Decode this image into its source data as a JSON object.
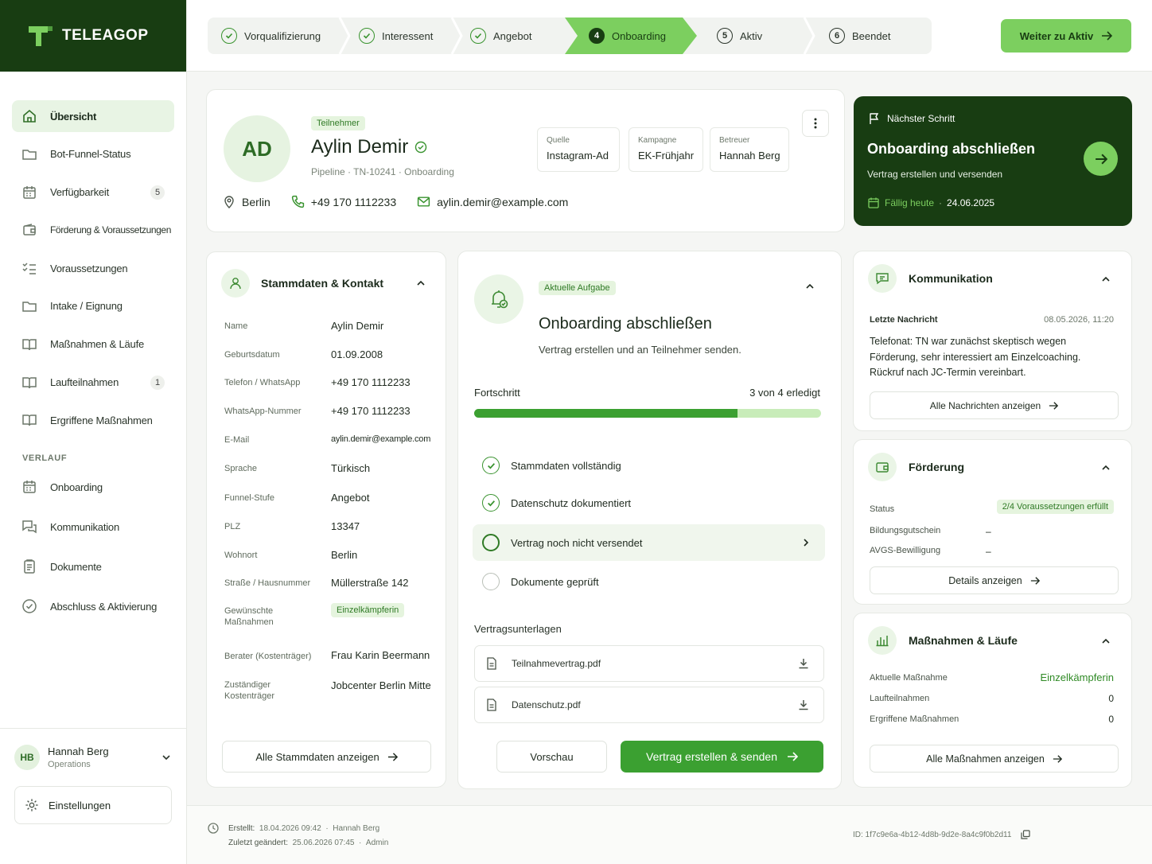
{
  "brand": {
    "name": "TELEAGOP"
  },
  "colors": {
    "brand_dark": "#183d12",
    "accent": "#7ccf5f",
    "primary": "#3ba031",
    "success": "#39932f"
  },
  "sidebar": {
    "items": [
      {
        "label": "Übersicht",
        "icon": "home-icon",
        "active": true
      },
      {
        "label": "Bot-Funnel-Status",
        "icon": "folder-icon"
      },
      {
        "label": "Verfügbarkeit",
        "icon": "calendar-icon",
        "badge": "5"
      },
      {
        "label": "Förderung & Voraussetzungen",
        "icon": "wallet-icon"
      },
      {
        "label": "Voraussetzungen",
        "icon": "checklist-icon"
      },
      {
        "label": "Intake / Eignung",
        "icon": "folder-icon"
      },
      {
        "label": "Maßnahmen & Läufe",
        "icon": "book-icon"
      },
      {
        "label": "Laufteilnahmen",
        "icon": "book-icon",
        "badge": "1"
      },
      {
        "label": "Ergriffene Maßnahmen",
        "icon": "book-icon"
      }
    ],
    "section_label": "VERLAUF",
    "history_items": [
      {
        "label": "Onboarding",
        "icon": "calendar-icon"
      },
      {
        "label": "Kommunikation",
        "icon": "chat-icon"
      },
      {
        "label": "Dokumente",
        "icon": "clipboard-icon"
      },
      {
        "label": "Abschluss & Aktivierung",
        "icon": "check-circle-icon"
      }
    ],
    "user": {
      "initials": "HB",
      "name": "Hannah Berg",
      "role": "Operations"
    },
    "settings_label": "Einstellungen"
  },
  "stepper": {
    "steps": [
      {
        "label": "Vorqualifizierung",
        "state": "done"
      },
      {
        "label": "Interessent",
        "state": "done"
      },
      {
        "label": "Angebot",
        "state": "done"
      },
      {
        "label": "Onboarding",
        "state": "active",
        "num": "4"
      },
      {
        "label": "Aktiv",
        "state": "todo",
        "num": "5"
      },
      {
        "label": "Beendet",
        "state": "todo",
        "num": "6"
      }
    ],
    "next_button": "Weiter zu Aktiv"
  },
  "profile": {
    "initials": "AD",
    "tag": "Teilnehmer",
    "name": "Aylin Demir",
    "pipeline": "Pipeline · TN-10241 · Onboarding",
    "city": "Berlin",
    "phone": "+49 170 1112233",
    "email": "aylin.demir@example.com",
    "info": [
      {
        "key": "Quelle",
        "value": "Instagram-Ad"
      },
      {
        "key": "Kampagne",
        "value": "EK-Frühjahr"
      },
      {
        "key": "Betreuer",
        "value": "Hannah Berg"
      }
    ]
  },
  "next_step": {
    "label": "Nächster Schritt",
    "title": "Onboarding abschließen",
    "desc": "Vertrag erstellen und versenden",
    "due": "Fällig heute",
    "date": "24.06.2025"
  },
  "stammdaten": {
    "title": "Stammdaten & Kontakt",
    "fields": [
      {
        "key": "Name",
        "value": "Aylin Demir"
      },
      {
        "key": "Geburtsdatum",
        "value": "01.09.2008"
      },
      {
        "key": "Telefon / WhatsApp",
        "value": "+49 170 1112233"
      },
      {
        "key": "WhatsApp-Nummer",
        "value": "+49 170 1112233"
      },
      {
        "key": "E-Mail",
        "value": "aylin.demir@example.com"
      },
      {
        "key": "Sprache",
        "value": "Türkisch"
      },
      {
        "key": "Funnel-Stufe",
        "value": "Angebot"
      },
      {
        "key": "PLZ",
        "value": "13347"
      },
      {
        "key": "Wohnort",
        "value": "Berlin"
      },
      {
        "key": "Straße / Hausnummer",
        "value": "Müllerstraße 142"
      },
      {
        "key": "Gewünschte Maßnahmen",
        "value": "Einzelkämpferin"
      },
      {
        "key": "Berater (Kostenträger)",
        "value": "Frau Karin Beermann"
      },
      {
        "key": "Zuständiger Kostenträger",
        "value": "Jobcenter Berlin Mitte"
      }
    ],
    "button": "Alle Stammdaten anzeigen"
  },
  "task": {
    "tag": "Aktuelle Aufgabe",
    "title": "Onboarding abschließen",
    "desc": "Vertrag erstellen und an Teilnehmer senden.",
    "progress_label": "Fortschritt",
    "progress_text": "3 von 4 erledigt",
    "progress_fraction": 0.76,
    "checklist": [
      {
        "label": "Stammdaten vollständig",
        "state": "done"
      },
      {
        "label": "Datenschutz dokumentiert",
        "state": "done"
      },
      {
        "label": "Vertrag noch nicht versendet",
        "state": "current"
      },
      {
        "label": "Dokumente geprüft",
        "state": "open"
      }
    ],
    "docs_label": "Vertragsunterlagen",
    "docs": [
      "Teilnahmevertrag.pdf",
      "Datenschutz.pdf"
    ],
    "preview_button": "Vorschau",
    "primary_button": "Vertrag erstellen & senden"
  },
  "kommunikation": {
    "title": "Kommunikation",
    "last_label": "Letzte Nachricht",
    "last_time": "08.05.2026, 11:20",
    "message": "Telefonat: TN war zunächst skeptisch wegen Förderung, sehr interessiert am Einzelcoaching. Rückruf nach JC-Termin vereinbart.",
    "button": "Alle Nachrichten anzeigen"
  },
  "foerderung": {
    "title": "Förderung",
    "status_label": "Status",
    "status_value": "2/4 Voraussetzungen erfüllt",
    "rows": [
      {
        "key": "Bildungsgutschein",
        "value": "–"
      },
      {
        "key": "AVGS-Bewilligung",
        "value": "–"
      }
    ],
    "button": "Details anzeigen"
  },
  "massnahmen": {
    "title": "Maßnahmen & Läufe",
    "rows": [
      {
        "key": "Aktuelle Maßnahme",
        "value": "Einzelkämpferin"
      },
      {
        "key": "Laufteilnahmen",
        "value": "0"
      },
      {
        "key": "Ergriffene Maßnahmen",
        "value": "0"
      }
    ],
    "button": "Alle Maßnahmen anzeigen"
  },
  "footer": {
    "created_label": "Erstellt:",
    "created": "18.04.2026 09:42",
    "created_by": "Hannah Berg",
    "changed_label": "Zuletzt geändert:",
    "changed": "25.06.2026 07:45",
    "changed_by": "Admin",
    "id": "ID: 1f7c9e6a-4b12-4d8b-9d2e-8a4c9f0b2d11"
  }
}
